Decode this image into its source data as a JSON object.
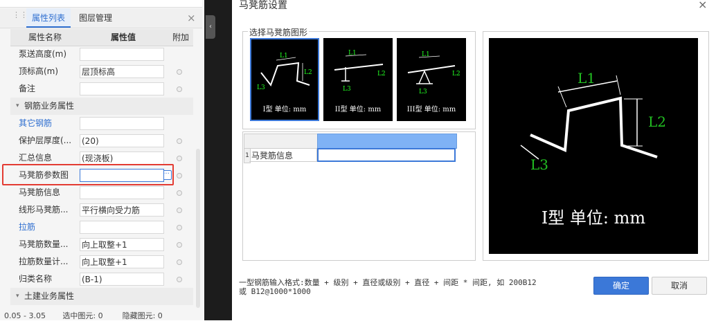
{
  "left_panel": {
    "tabs": [
      {
        "label": "属性列表",
        "active": true
      },
      {
        "label": "图层管理",
        "active": false
      }
    ],
    "close_label": "×",
    "columns": {
      "name": "属性名称",
      "value": "属性值",
      "extra": "附加"
    },
    "rows": [
      {
        "name": "泵送高度(m)",
        "value": "",
        "blue": false,
        "dot": false
      },
      {
        "name": "顶标高(m)",
        "value": "层顶标高",
        "blue": false,
        "dot": true
      },
      {
        "name": "备注",
        "value": "",
        "blue": false,
        "dot": true
      },
      {
        "group": "钢筋业务属性"
      },
      {
        "name": "其它钢筋",
        "value": "",
        "blue": true,
        "dot": false
      },
      {
        "name": "保护层厚度(...",
        "value": "(20)",
        "blue": false,
        "dot": true
      },
      {
        "name": "汇总信息",
        "value": "(现浇板)",
        "blue": false,
        "dot": true
      },
      {
        "name": "马凳筋参数图",
        "value": "",
        "blue": false,
        "dot": true,
        "highlight": true
      },
      {
        "name": "马凳筋信息",
        "value": "",
        "blue": false,
        "dot": true
      },
      {
        "name": "线形马凳筋...",
        "value": "平行横向受力筋",
        "blue": false,
        "dot": true
      },
      {
        "name": "拉筋",
        "value": "",
        "blue": true,
        "dot": true
      },
      {
        "name": "马凳筋数量...",
        "value": "向上取整+1",
        "blue": false,
        "dot": true
      },
      {
        "name": "拉筋数量计...",
        "value": "向上取整+1",
        "blue": false,
        "dot": true
      },
      {
        "name": "归类名称",
        "value": "(B-1)",
        "blue": false,
        "dot": true
      },
      {
        "group": "土建业务属性"
      }
    ],
    "status_text": "0.05 - 3.05       选中图元: 0        隐藏图元: 0"
  },
  "dialog": {
    "title": "马凳筋设置",
    "close_label": "×",
    "shape_group_label": "选择马凳筋图形",
    "shapes": [
      {
        "caption": "I型 单位: mm",
        "selected": true
      },
      {
        "caption": "II型 单位: mm",
        "selected": false
      },
      {
        "caption": "III型 单位: mm",
        "selected": false
      }
    ],
    "grid": {
      "row_number": "1",
      "row_label": "马凳筋信息",
      "row_value": ""
    },
    "preview": {
      "labels": [
        "L1",
        "L2",
        "L3"
      ],
      "caption": "I型 单位: mm"
    },
    "hint_line1": "一型钢筋输入格式:数量 + 级别 + 直径或级别 + 直径 + 间距 * 间距, 如 200B12",
    "hint_line2": "或 B12@1000*1000",
    "ok_label": "确定",
    "cancel_label": "取消",
    "colors": {
      "accent": "#3b78d8",
      "dimension": "#22c022",
      "highlight": "#e33b32"
    }
  }
}
